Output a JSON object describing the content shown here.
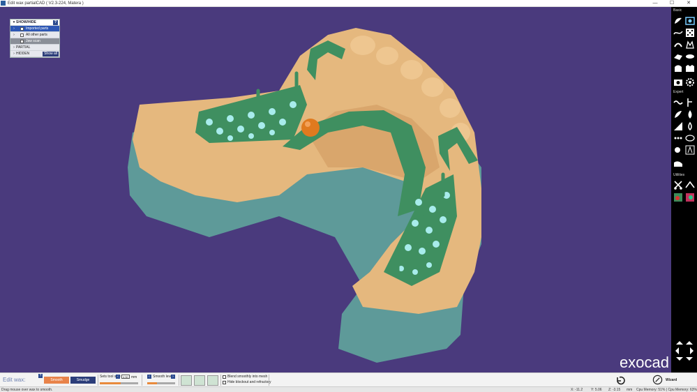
{
  "window": {
    "title": "Edit wax partialCAD ( V2.3-224, Matera )",
    "min": "—",
    "max": "☐",
    "close": "✕"
  },
  "showhide": {
    "header": "SHOW/HIDE",
    "help": "?",
    "items": [
      {
        "label": "Imported parts",
        "state": "selected"
      },
      {
        "label": "All other parts",
        "state": "normal"
      },
      {
        "label": "Jaw scan",
        "state": "gray"
      }
    ],
    "partial": "PARTIAL",
    "hidden": "HIDDEN",
    "show_all": "Show all"
  },
  "logo": "exocad",
  "rightbar": {
    "basic": "Basic",
    "expert": "Expert",
    "utilities": "Utilities",
    "wizard": "Wizard"
  },
  "bottom": {
    "mode_title": "Edit wax:",
    "help": "?",
    "smooth": "Smooth",
    "smudge": "Smudge",
    "tool_size_label": "Sets tool size",
    "tool_size_value": "4.50",
    "tool_size_unit": "mm",
    "tool_size_level": 0.55,
    "smooth_level_label": "Smooth level",
    "smooth_level": 0.35,
    "blend_label": "Blend smoothly into mesh",
    "hide_label": "Hide blockout and refractory"
  },
  "status": {
    "hint": "Drag mouse over wax to smooth.",
    "x": "X: -11.2",
    "y": "Y: 5.06",
    "z": "Z: -3.15",
    "unit": "mm",
    "memory": "Cpu Memory: 51% | Cpu Memory: 63%"
  },
  "colors": {
    "viewport_bg": "#4a3a7d",
    "stone": "#e5b87e",
    "stone_side": "#5e9a99",
    "wax": "#3f8f60",
    "wax_light": "#a8ecec",
    "ball": "#e07a1f",
    "smooth_button": "#e8834a",
    "smudge_button": "#2c3e7a"
  }
}
